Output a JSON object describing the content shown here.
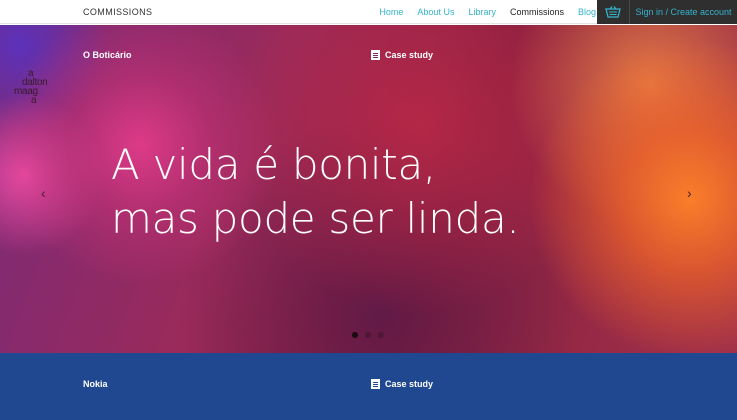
{
  "header": {
    "brand": "COMMISSIONS",
    "nav": [
      {
        "label": "Home",
        "active": false
      },
      {
        "label": "About Us",
        "active": false
      },
      {
        "label": "Library",
        "active": false
      },
      {
        "label": "Commissions",
        "active": true
      },
      {
        "label": "Blog",
        "active": false
      }
    ],
    "basket_icon": "basket-icon",
    "signin_label": "Sign in / Create account"
  },
  "hero": {
    "client": "O Boticário",
    "type_label": "Case study",
    "logo_lines": [
      "a",
      "dalton",
      "maag",
      "a"
    ],
    "headline_line1": "A vida é bonita,",
    "headline_line2": "mas pode ser linda.",
    "prev_arrow": "‹",
    "next_arrow": "›",
    "slide_count": 3,
    "active_slide": 1
  },
  "next_item": {
    "client": "Nokia",
    "type_label": "Case study"
  },
  "colors": {
    "accent": "#35b3cc",
    "dark_bar": "#2f2f2f",
    "panel_blue": "#1f4890"
  }
}
